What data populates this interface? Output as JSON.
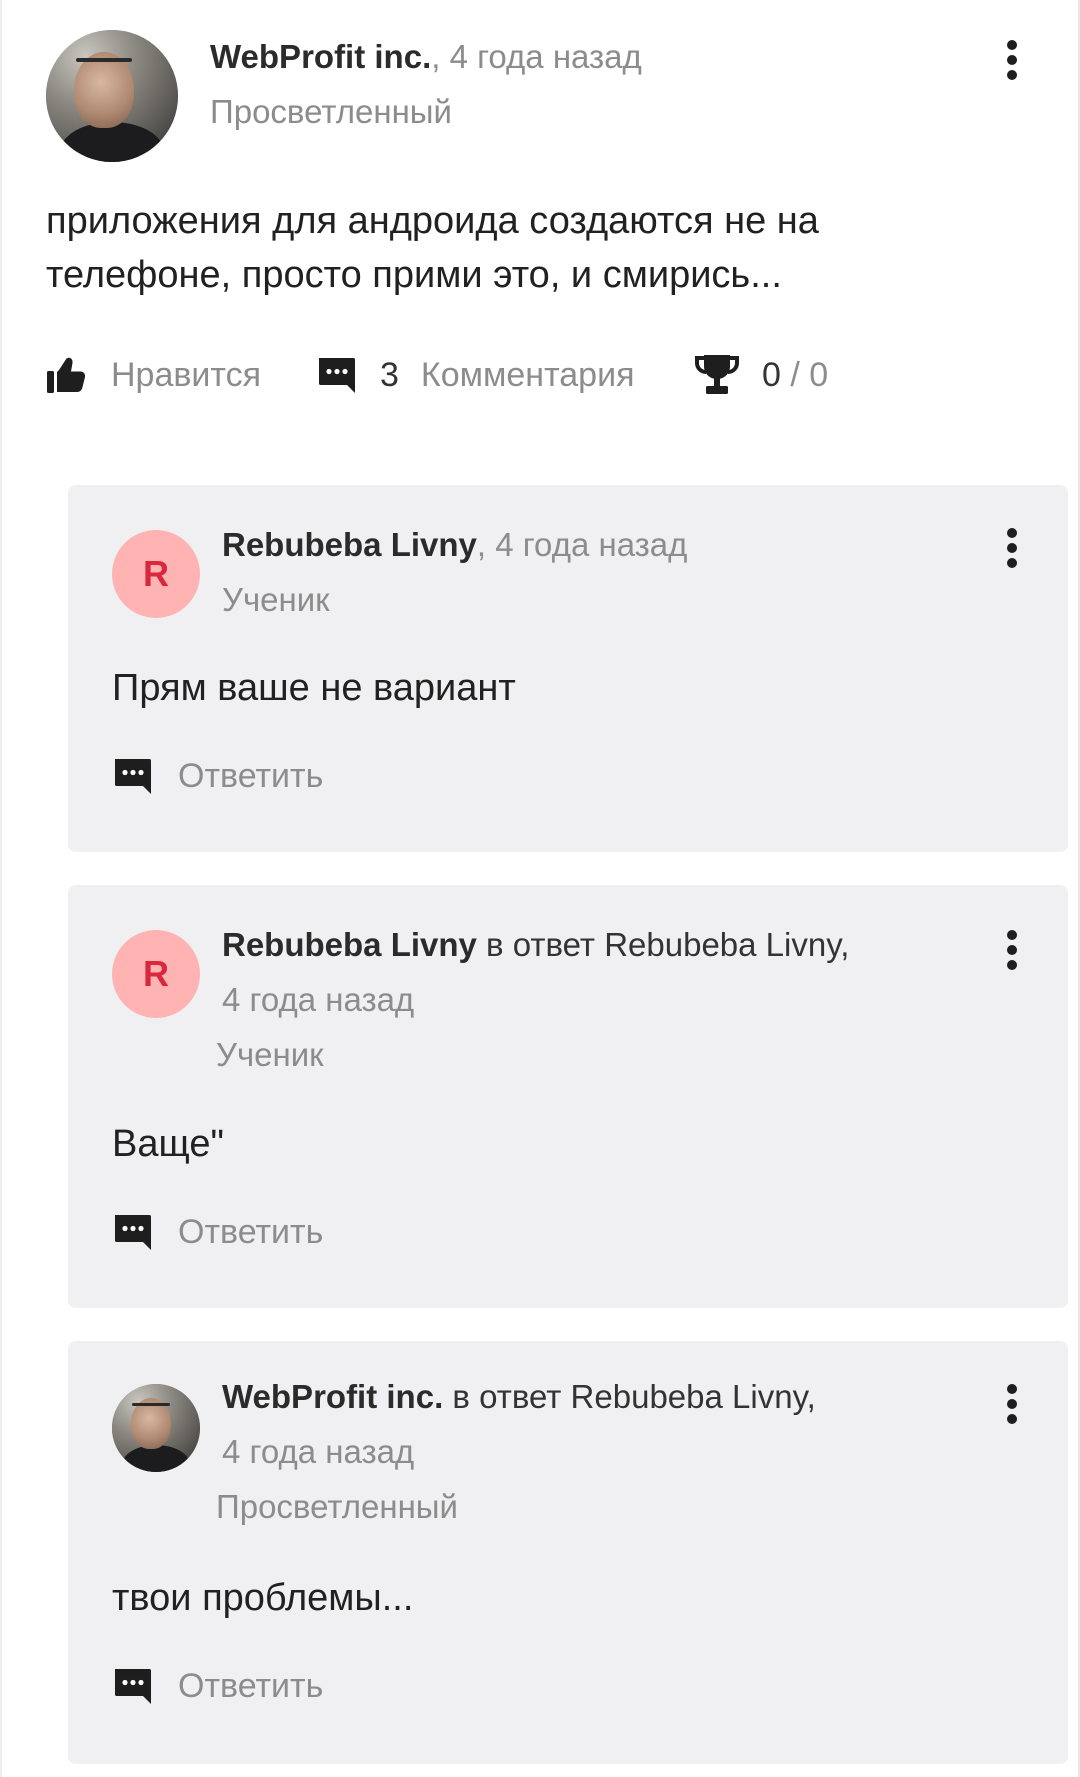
{
  "post": {
    "author": "WebProfit inc.",
    "time": ", 4 года назад",
    "rank": "Просветленный",
    "text": "приложения для андроида создаются не на телефоне, просто прими это, и смирись...",
    "actions": {
      "like_label": "Нравится",
      "comments_count": "3",
      "comments_label": "Комментария",
      "score_value": "0",
      "score_separator": " / ",
      "score_total": "0"
    }
  },
  "comments": [
    {
      "avatar_letter": "R",
      "author": "Rebubeba Livny",
      "time": ", 4 года назад",
      "rank": "Ученик",
      "text": "Прям ваше не вариант",
      "reply_label": "Ответить"
    },
    {
      "avatar_letter": "R",
      "author": "Rebubeba Livny",
      "reply_to": " в ответ Rebubeba Livny,",
      "time": "4 года назад",
      "rank": "Ученик",
      "text": "Ваще\"",
      "reply_label": "Ответить"
    },
    {
      "author": "WebProfit inc.",
      "reply_to": " в ответ Rebubeba Livny,",
      "time": "4 года назад",
      "rank": "Просветленный",
      "text": "твои проблемы...",
      "reply_label": "Ответить"
    }
  ],
  "colors": {
    "letter_avatar_bg": "#ffb3b3",
    "letter_avatar_fg": "#d8283d",
    "comment_bg": "#f0f0f2",
    "muted_text": "#8c8c8c"
  },
  "icons": {
    "like": "thumbs-up-icon",
    "comments": "comment-bubble-icon",
    "score": "trophy-icon",
    "more": "more-vertical-icon",
    "reply": "comment-bubble-icon"
  }
}
